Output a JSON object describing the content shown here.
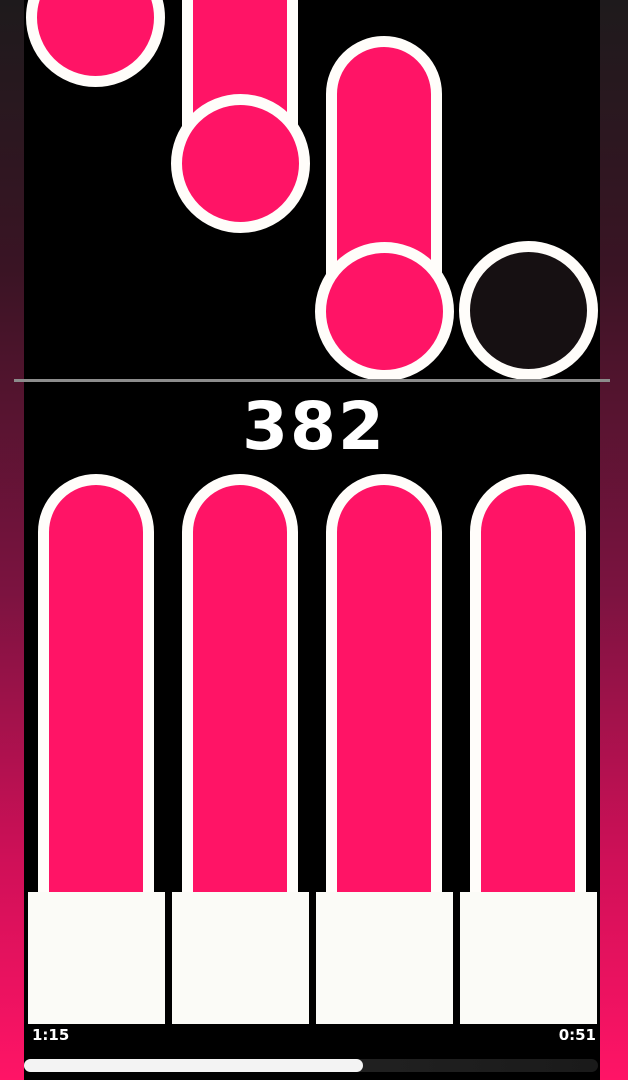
{
  "game": {
    "score": "382",
    "elapsed_time": "1:15",
    "remaining_time": "0:51",
    "progress_fraction": 0.59,
    "lanes": 4
  },
  "colors": {
    "note_pink": "#ff1466",
    "note_outline": "#fffdfa",
    "key_white": "#fbfbf7",
    "background": "#000000"
  }
}
